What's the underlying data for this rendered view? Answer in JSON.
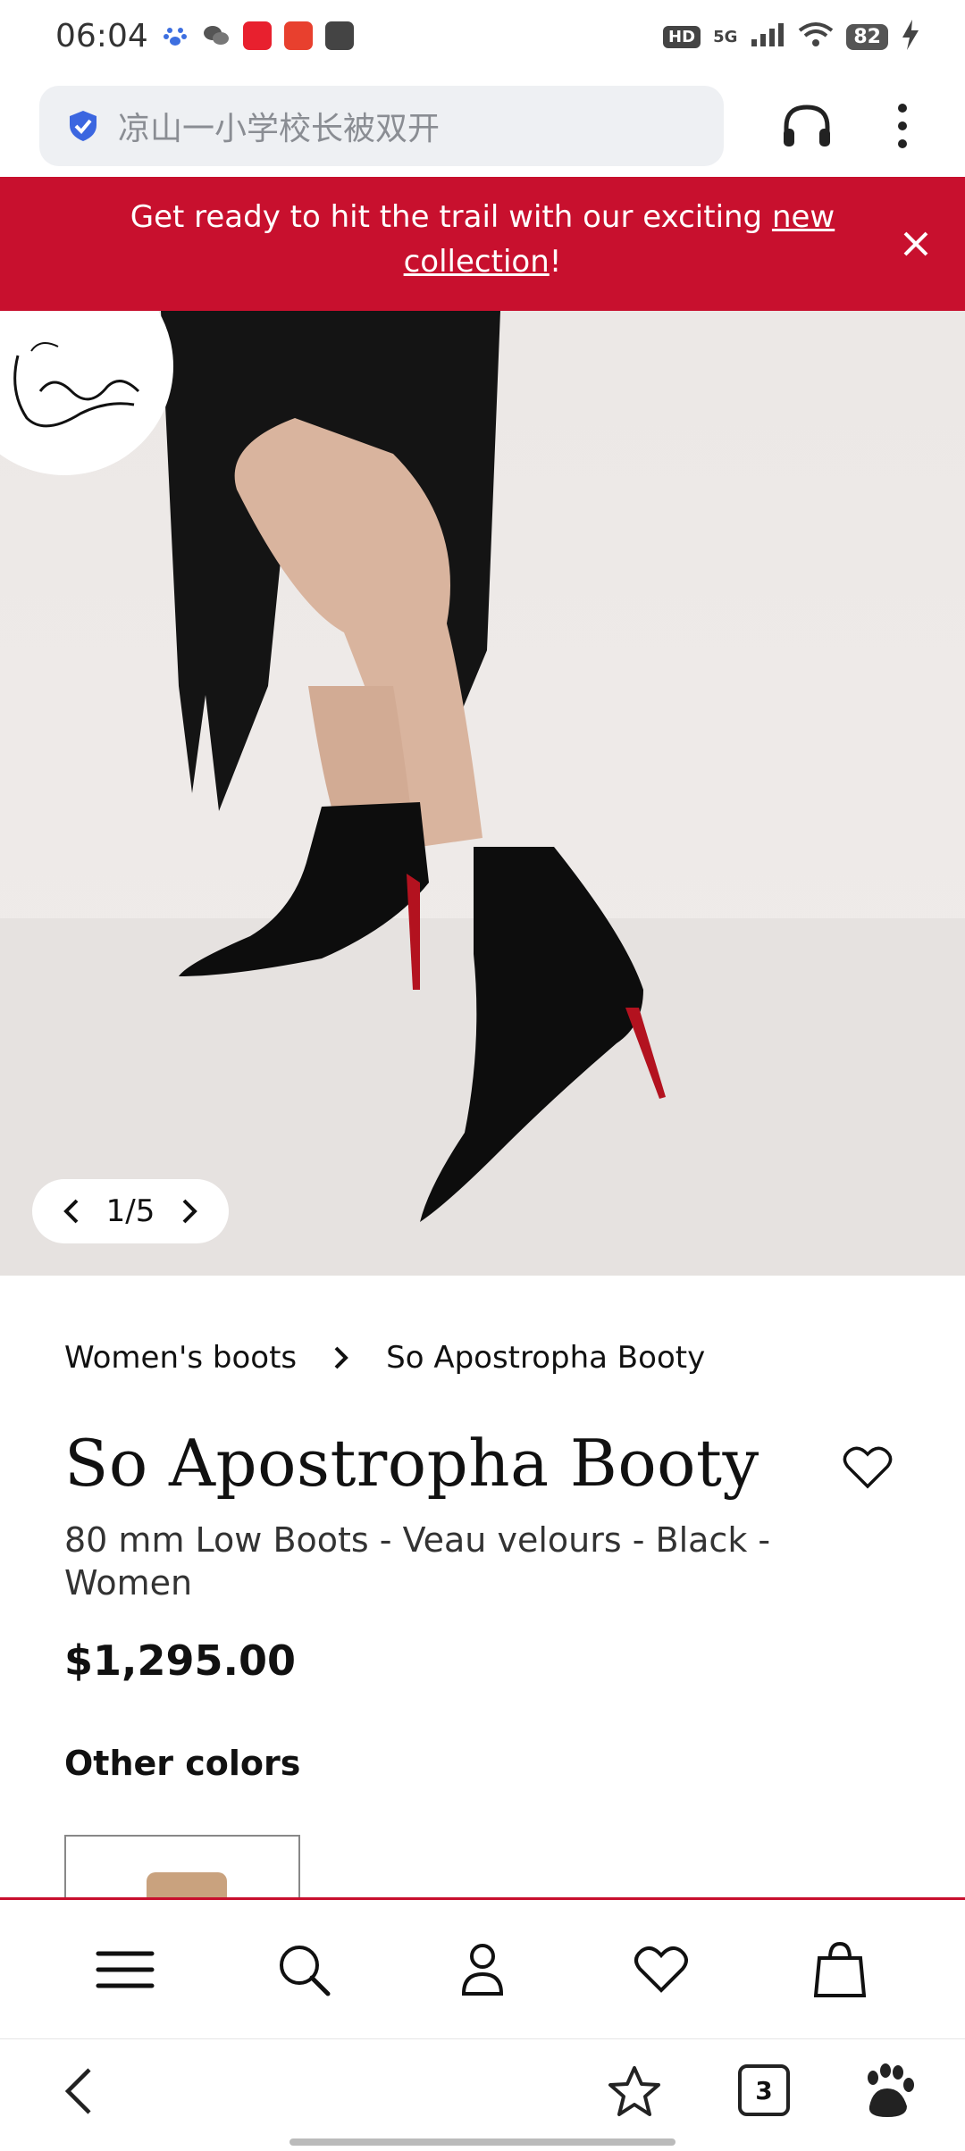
{
  "status_bar": {
    "time": "06:04",
    "network": "5G",
    "hd": "HD",
    "battery": "82"
  },
  "browser": {
    "address_placeholder": "凉山一小学校长被双开",
    "tab_count": "3"
  },
  "banner": {
    "text_before": "Get ready to hit the trail with our exciting ",
    "link": "new collection",
    "text_after": "!"
  },
  "gallery": {
    "pager": "1/5",
    "current": 1,
    "total": 5
  },
  "breadcrumb": {
    "parent": "Women's boots",
    "current": "So Apostropha Booty"
  },
  "product": {
    "title": "So Apostropha Booty",
    "subtitle": "80 mm Low Boots - Veau velours - Black - Women",
    "price": "$1,295.00",
    "other_colors_label": "Other colors"
  },
  "icons": {
    "status": [
      "paw-icon",
      "wechat-icon",
      "app-icon",
      "app-icon",
      "mail-icon",
      "signal-icon",
      "wifi-icon",
      "charging-icon"
    ],
    "address": [
      "shield-icon",
      "headphones-icon",
      "more-icon"
    ],
    "site_nav": [
      "menu-icon",
      "search-icon",
      "account-icon",
      "heart-icon",
      "bag-icon"
    ],
    "browser_bar": [
      "back-icon",
      "star-icon",
      "tabs-icon",
      "baidu-paw-icon"
    ]
  },
  "colors": {
    "brand_red": "#c8102e",
    "address_bg": "#eef0f3",
    "boot_black": "#111111",
    "sole_red": "#b3121f"
  }
}
